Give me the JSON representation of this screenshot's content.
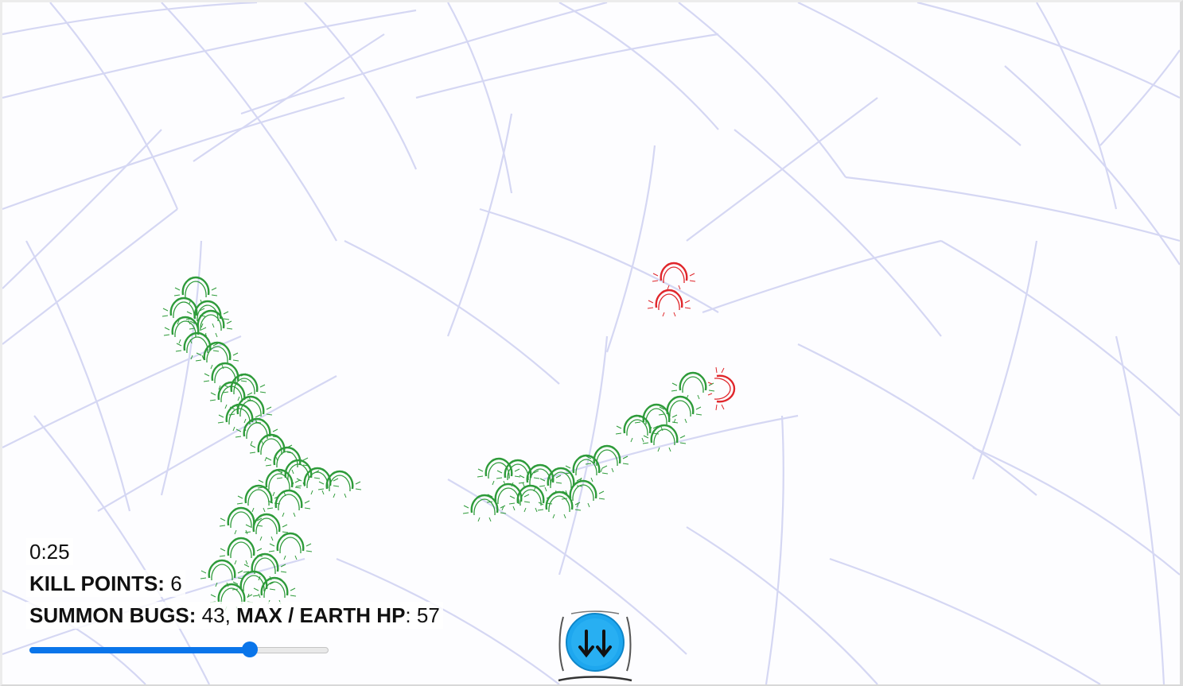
{
  "hud": {
    "timer": "0:25",
    "kill_points_label": "KILL POINTS:",
    "kill_points_value": "6",
    "summon_label": "SUMMON BUGS:",
    "summon_value": "43",
    "separator": ",",
    "hp_label": "MAX / EARTH HP",
    "hp_colon": ":",
    "hp_value": "57"
  },
  "slider": {
    "value_fraction": 0.74,
    "accent_color": "#0a75ea"
  },
  "portal": {
    "icon": "double-down-arrow-icon",
    "color": "#1ea7ef"
  },
  "colors": {
    "ally_bug": "#2e9b3a",
    "enemy_bug": "#e0262b",
    "web_lines": "#c8cbf0"
  }
}
